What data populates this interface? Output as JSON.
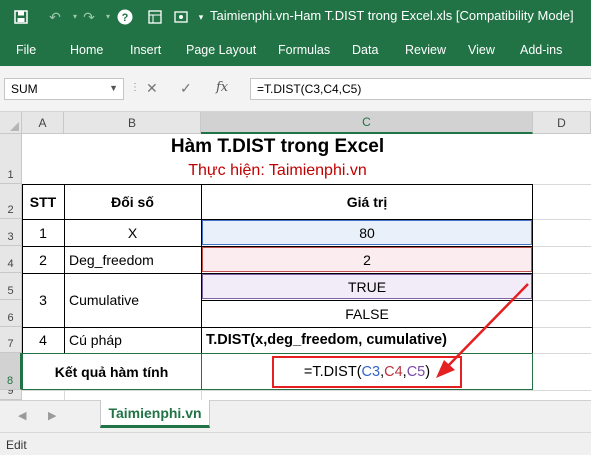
{
  "window": {
    "title": "Taimienphi.vn-Ham T.DIST trong Excel.xls  [Compatibility Mode]",
    "quick_access": [
      "save-icon",
      "undo-icon",
      "redo-icon",
      "help-icon",
      "template-icon",
      "touch-mode-icon",
      "customize-icon"
    ]
  },
  "ribbon": {
    "tabs": [
      "File",
      "Home",
      "Insert",
      "Page Layout",
      "Formulas",
      "Data",
      "Review",
      "View",
      "Add-ins"
    ]
  },
  "formula_bar": {
    "name_box": "SUM",
    "formula": "=T.DIST(C3,C4,C5)",
    "fx_label": "fx"
  },
  "grid": {
    "columns": [
      "A",
      "B",
      "C",
      "D"
    ],
    "selected_column": "C",
    "rows": [
      "1",
      "2",
      "3",
      "4",
      "5",
      "6",
      "7",
      "8",
      "9"
    ],
    "selected_row": "8",
    "title": "Hàm T.DIST trong Excel",
    "subtitle": "Thực hiện: Taimienphi.vn",
    "headers": {
      "stt": "STT",
      "arg": "Đối số",
      "value": "Giá trị"
    },
    "data_rows": [
      {
        "stt": "1",
        "arg": "X",
        "value": "80"
      },
      {
        "stt": "2",
        "arg": "Deg_freedom",
        "value": "2"
      },
      {
        "stt": "3",
        "arg": "Cumulative",
        "value_true": "TRUE",
        "value_false": "FALSE"
      },
      {
        "stt": "4",
        "arg": "Cú pháp",
        "value": "T.DIST(x,deg_freedom, cumulative)"
      }
    ],
    "result_label": "Kết quả hàm tính",
    "result_formula": {
      "prefix": "=T.DIST(",
      "ref1": "C3",
      "sep1": ",",
      "ref2": "C4",
      "sep2": ",",
      "ref3": "C5",
      "suffix": ")"
    }
  },
  "sheets": {
    "active": "Taimienphi.vn"
  },
  "status": {
    "mode": "Edit"
  },
  "colors": {
    "accent": "#217346",
    "subtitle": "#c00000",
    "ref1": "#3366cc",
    "ref2": "#b5343e",
    "ref3": "#7a4aa8",
    "arrow": "#e52020"
  }
}
